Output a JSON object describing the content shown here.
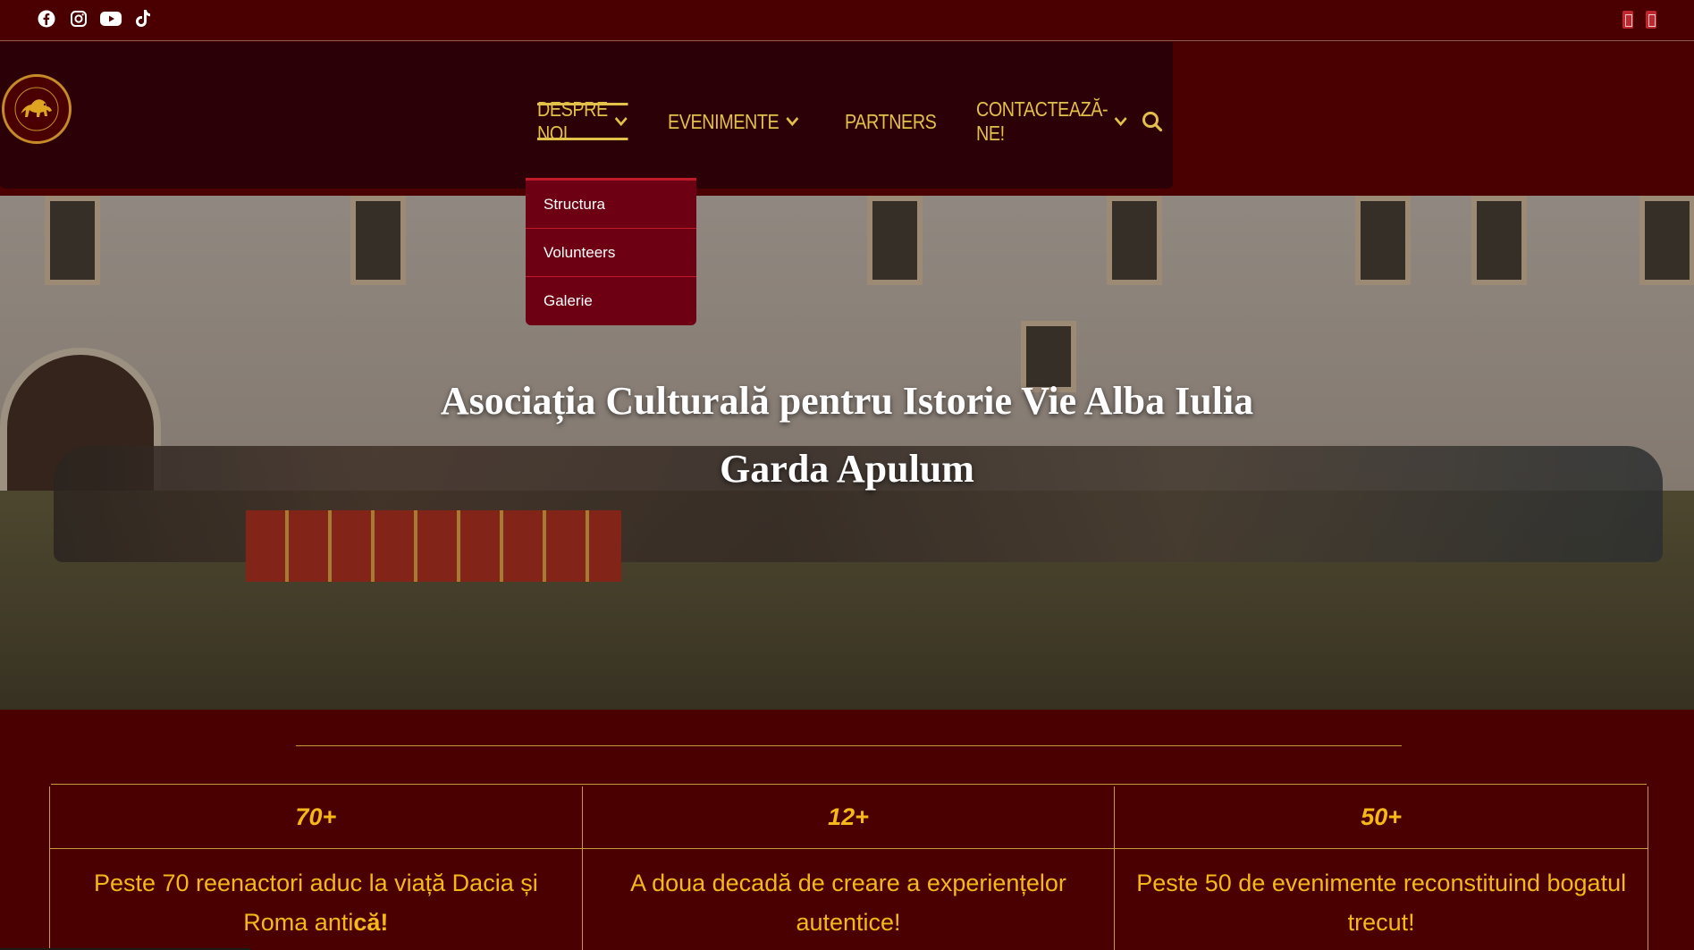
{
  "topbar": {
    "social_icons": [
      "facebook-icon",
      "instagram-icon",
      "youtube-icon",
      "tiktok-icon"
    ],
    "language_flags": [
      "flag-icon",
      "flag-icon"
    ]
  },
  "header": {
    "logo_alt": "Garda Apulum lion logo",
    "nav": [
      {
        "label": "Despre noi",
        "has_dropdown": true,
        "active": true
      },
      {
        "label": "Evenimente",
        "has_dropdown": true,
        "active": false
      },
      {
        "label": "Partners",
        "has_dropdown": false,
        "active": false
      },
      {
        "label": "Contactează-ne!",
        "has_dropdown": true,
        "active": false
      }
    ],
    "search_icon": "search-icon"
  },
  "dropdown": {
    "items": [
      "Structura",
      "Volunteers",
      "Galerie"
    ]
  },
  "hero": {
    "title_line1": "Asociația Culturală pentru Istorie Vie Alba Iulia",
    "title_line2": "Garda Apulum"
  },
  "stats": [
    {
      "number": "70+",
      "desc_plain": "Peste 70 reenactori aduc la viață Dacia și Roma anti",
      "desc_bold": "că!"
    },
    {
      "number": "12+",
      "desc_plain": "A doua decadă de creare a experiențelor autentice!",
      "desc_bold": ""
    },
    {
      "number": "50+",
      "desc_plain": "Peste 50 de evenimente reconstituind bogatul trecut!",
      "desc_bold": ""
    }
  ],
  "colors": {
    "background": "#4a0000",
    "header_bg": "#2b0006",
    "nav_text": "#e3c04a",
    "stat_text": "#f5b818",
    "dropdown_bg": "#6d0012"
  }
}
